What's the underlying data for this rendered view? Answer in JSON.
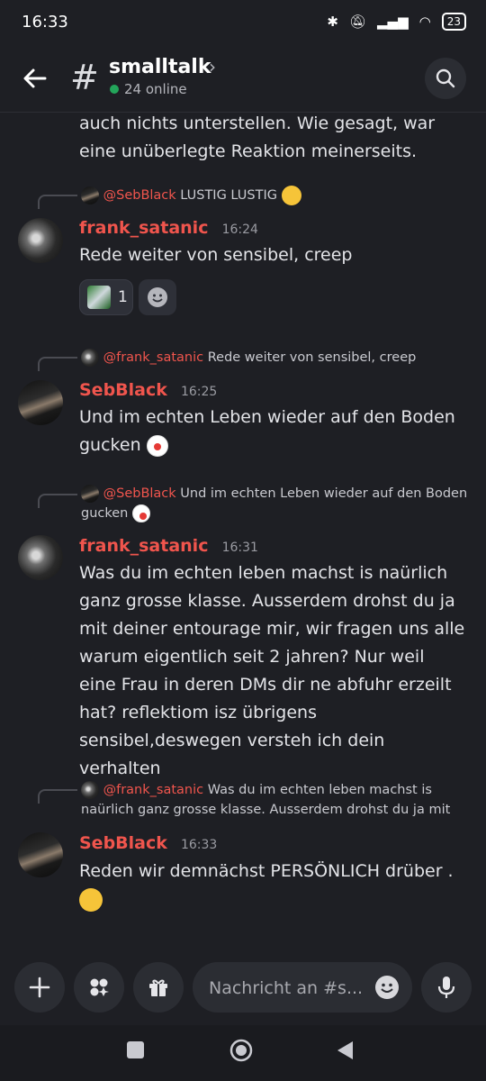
{
  "status_bar": {
    "time": "16:33",
    "battery": "23"
  },
  "header": {
    "channel": "smalltalk",
    "online": "24 online"
  },
  "messages": {
    "partial": {
      "text": "auch nichts unterstellen. Wie gesagt, war eine unüberlegte Reaktion meinerseits."
    },
    "m1": {
      "reply_mention": "@SebBlack",
      "reply_text": "LUSTIG LUSTIG",
      "author": "frank_satanic",
      "time": "16:24",
      "text": "Rede weiter von sensibel, creep",
      "reaction_count": "1"
    },
    "m2": {
      "reply_mention": "@frank_satanic",
      "reply_text": "Rede weiter von sensibel, creep",
      "author": "SebBlack",
      "time": "16:25",
      "text": "Und im echten Leben wieder auf den Boden gucken"
    },
    "m3": {
      "reply_mention": "@SebBlack",
      "reply_text": "Und im echten Leben wieder auf den Boden gucken",
      "author": "frank_satanic",
      "time": "16:31",
      "text": "Was du im echten leben machst is naürlich ganz grosse klasse. Ausserdem drohst du ja mit deiner entourage mir, wir fragen uns alle warum eigentlich seit 2 jahren? Nur weil eine Frau in deren DMs dir ne abfuhr erzeilt hat? reflektiom isz übrigens sensibel,deswegen versteh ich dein verhalten"
    },
    "m4": {
      "reply_mention": "@frank_satanic",
      "reply_text": "Was du im echten leben machst is naürlich ganz grosse klasse. Ausserdem drohst du ja mit",
      "author": "SebBlack",
      "time": "16:33",
      "text": "Reden wir demnächst PERSÖNLICH drüber ."
    }
  },
  "composer": {
    "placeholder": "Nachricht an #s..."
  },
  "colors": {
    "background": "#1e1f24",
    "username": "#f0554d",
    "online": "#23a55a"
  }
}
